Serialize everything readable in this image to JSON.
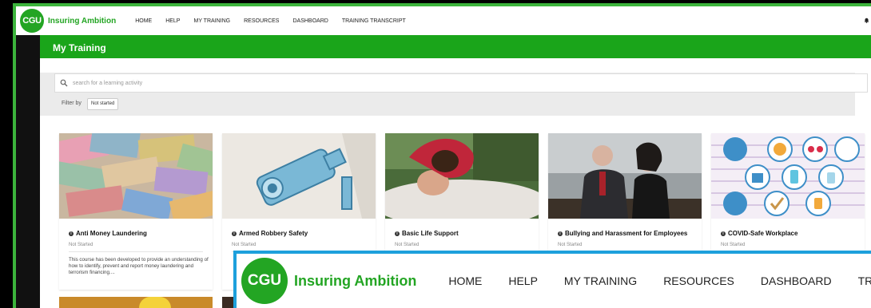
{
  "app": {
    "logo_text": "CGU",
    "brand": "Insuring Ambition"
  },
  "nav": [
    "HOME",
    "HELP",
    "MY TRAINING",
    "RESOURCES",
    "DASHBOARD",
    "TRAINING TRANSCRIPT"
  ],
  "banner": {
    "title": "My Training"
  },
  "search": {
    "placeholder": "search for a learning activity"
  },
  "filter": {
    "label": "Filter by",
    "value": "Not started"
  },
  "cards": [
    {
      "title": "Anti Money Laundering",
      "status": "Not Started",
      "description": "This course has been developed to provide an understanding of how to identify, prevent and report money laundering and terrorism financing...."
    },
    {
      "title": "Armed Robbery Safety",
      "status": "Not Started",
      "description": ""
    },
    {
      "title": "Basic Life Support",
      "status": "Not Started",
      "description": ""
    },
    {
      "title": "Bullying and Harassment for Employees",
      "status": "Not Started",
      "description": ""
    },
    {
      "title": "COVID-Safe Workplace",
      "status": "Not Started",
      "description": ""
    }
  ],
  "zoom": {
    "logo_text": "CGU",
    "brand": "Insuring Ambition",
    "nav": [
      "HOME",
      "HELP",
      "MY TRAINING",
      "RESOURCES",
      "DASHBOARD",
      "TRAINING"
    ]
  },
  "colors": {
    "brand_green": "#23a523",
    "banner_green": "#1aa51a",
    "frame_green": "#3cb43c",
    "zoom_border": "#1ea0dc"
  }
}
